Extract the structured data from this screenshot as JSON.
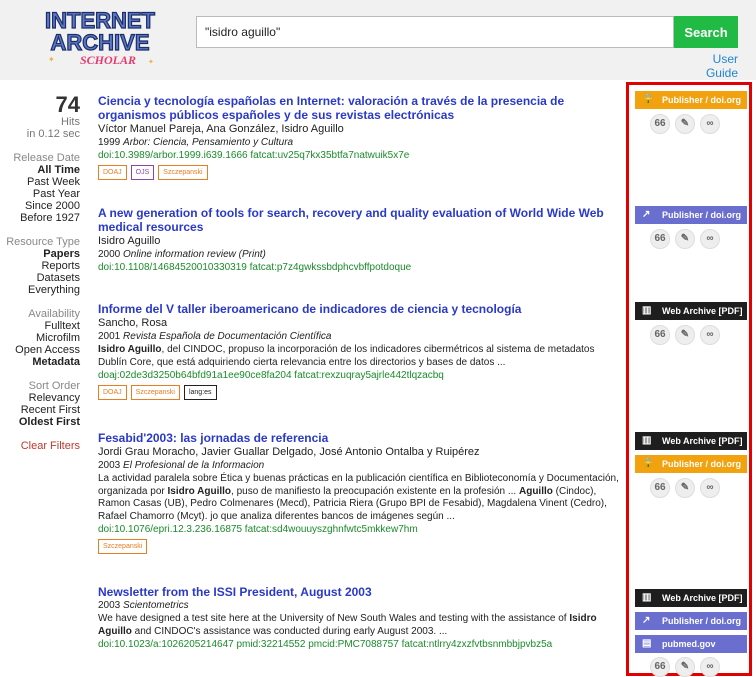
{
  "header": {
    "logo_text_1": "INTERNET",
    "logo_text_2": "ARCHIVE",
    "logo_text_3": "SCHOLAR",
    "search_value": "\"isidro aguillo\"",
    "search_button": "Search",
    "user_guide": "User Guide"
  },
  "sidebar": {
    "hits": "74",
    "hits_label": "Hits",
    "hits_time": "in 0.12 sec",
    "release_title": "Release Date",
    "release_options": [
      "All Time",
      "Past Week",
      "Past Year",
      "Since 2000",
      "Before 1927"
    ],
    "resource_title": "Resource Type",
    "resource_options": [
      "Papers",
      "Reports",
      "Datasets",
      "Everything"
    ],
    "availability_title": "Availability",
    "availability_options": [
      "Fulltext",
      "Microfilm",
      "Open Access",
      "Metadata"
    ],
    "sort_title": "Sort Order",
    "sort_options": [
      "Relevancy",
      "Recent First",
      "Oldest First"
    ],
    "clear_filters": "Clear Filters"
  },
  "results": [
    {
      "title": "Ciencia y tecnología españolas en Internet: valoración a través de la presencia de organismos públicos españoles y de sus revistas electrónicas",
      "authors": "Víctor Manuel Pareja, Ana González, Isidro Aguillo",
      "year": "1999",
      "venue": "Arbor: Ciencia, Pensamiento y Cultura",
      "ids": "doi:10.3989/arbor.1999.i639.1666  fatcat:uv25q7kx35btfa7natwuik5x7e",
      "tags": [
        "DOAJ",
        "OJS",
        "Szczepanski"
      ]
    },
    {
      "title": "A new generation of tools for search, recovery and quality evaluation of World Wide Web medical resources",
      "authors": "Isidro Aguillo",
      "year": "2000",
      "venue": "Online information review (Print)",
      "ids": "doi:10.1108/14684520010330319  fatcat:p7z4gwkssbdphcvbffpotdoque"
    },
    {
      "title": "Informe del V taller iberoamericano de indicadores de ciencia y tecnología",
      "authors": "Sancho, Rosa",
      "year": "2001",
      "venue": "Revista Española de Documentación Científica",
      "abstract_bold": "Isidro Aguillo",
      "abstract": ", del CINDOC, propuso la incorporación de los indicadores cibermétricos al sistema de metadatos Dublín Core, que está adquiriendo cierta relevancia entre los directorios y bases de datos ...",
      "ids": "doaj:02de3d3250b64bfd91a1ee90ce8fa204  fatcat:rexzuqray5ajrle442tlqzacbq",
      "tags": [
        "DOAJ",
        "Szczepanski",
        "lang:es"
      ]
    },
    {
      "title": "Fesabid'2003: las jornadas de referencia",
      "authors": "Jordi Grau Moracho, Javier Guallar Delgado, José Antonio Ontalba y Ruipérez",
      "year": "2003",
      "venue": "El Profesional de la Informacion",
      "abstract_1": "La actividad paralela sobre Ética y buenas prácticas en la publicación científica en Biblioteconomía y Documentación, organizada por ",
      "abstract_bold_1": "Isidro Aguillo",
      "abstract_2": ", puso de manifiesto la preocupación existente en la profesión ... ",
      "abstract_bold_2": "Aguillo",
      "abstract_3": " (Cindoc), Ramon Casas (UB), Pedro Colmenares (Mecd), Patricia Riera (Grupo BPI de Fesabid), Magdalena Vinent (Cedro), Rafael Chamorro (Mcyt). jo que analiza diferentes bancos de imágenes según ...",
      "ids": "doi:10.1076/epri.12.3.236.16875  fatcat:sd4wouuyszghnfwtc5mkkew7hm",
      "tags": [
        "Szczepanski"
      ]
    },
    {
      "title": "Newsletter from the ISSI President, August 2003",
      "year": "2003",
      "venue": "Scientometrics",
      "abstract_1": "We have designed a test site here at the University of New South Wales and testing with the assistance of ",
      "abstract_bold_1": "Isidro Aguillo",
      "abstract_2": " and CINDOC's assistance was conducted during early August 2003. ...",
      "ids": "doi:10.1023/a:1026205214647  pmid:32214552  pmcid:PMC7088757  fatcat:ntlrry4zxzfvtbsnmbbjpvbz5a"
    }
  ],
  "access": {
    "publisher": "Publisher / doi.org",
    "web_archive": "Web Archive [PDF]",
    "pubmed": "pubmed.gov"
  },
  "icons": {
    "cite": "66",
    "edit": "✎",
    "link": "🔗"
  },
  "colors": {
    "accent_green": "#21ba45",
    "title_blue": "#2a39c8",
    "id_green": "#1a8b2a",
    "highlight_red": "#e30000"
  }
}
